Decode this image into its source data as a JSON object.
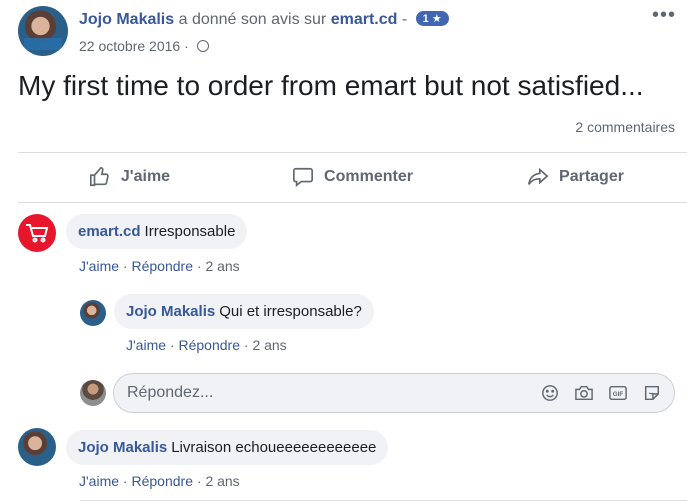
{
  "post": {
    "author": "Jojo Makalis",
    "action_text": "a donné son avis sur",
    "page": "emart.cd",
    "separator": " - ",
    "rating_badge": "1 ★",
    "date": "22 octobre 2016",
    "date_sep": " · ",
    "body": "My first time to order from emart but not satisfied...",
    "comment_count": "2 commentaires",
    "more": "•••"
  },
  "actions": {
    "like": "J'aime",
    "comment": "Commenter",
    "share": "Partager"
  },
  "comments": [
    {
      "author": "emart.cd",
      "text": "Irresponsable",
      "like": "J'aime",
      "reply": "Répondre",
      "time": "2 ans"
    },
    {
      "author": "Jojo Makalis",
      "text": "Qui et irresponsable?",
      "like": "J'aime",
      "reply": "Répondre",
      "time": "2 ans"
    },
    {
      "author": "Jojo Makalis",
      "text": "Livraison echoueeeeeeeeeeee",
      "like": "J'aime",
      "reply": "Répondre",
      "time": "2 ans"
    }
  ],
  "meta_sep": " · ",
  "reply_box": {
    "placeholder": "Répondez...",
    "icons": [
      "smiley-icon",
      "camera-icon",
      "gif-icon",
      "sticker-icon"
    ]
  }
}
